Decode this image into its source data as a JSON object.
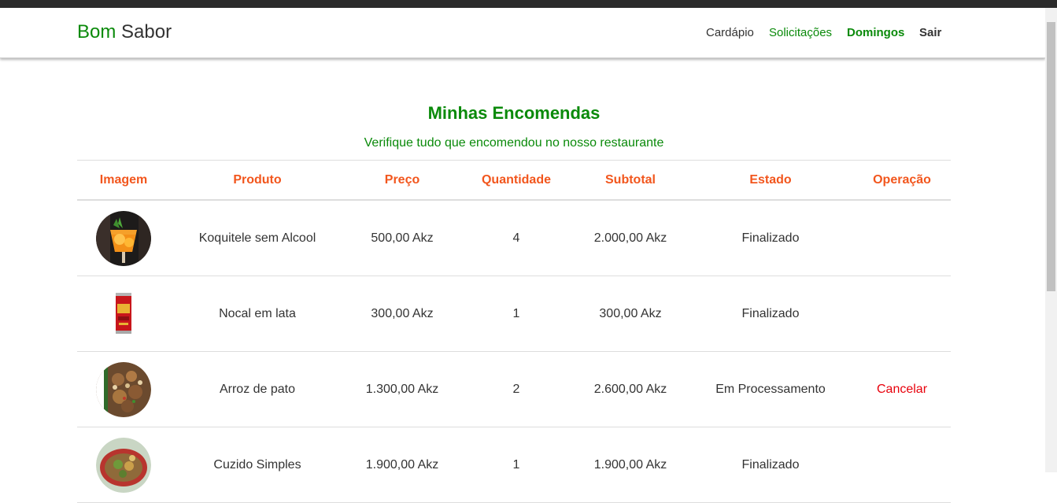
{
  "nav": {
    "brand_part1": "Bom",
    "brand_part2": "Sabor",
    "links": {
      "cardapio": "Cardápio",
      "solicitacoes": "Solicitações",
      "user": "Domingos",
      "sair": "Sair"
    }
  },
  "page": {
    "title": "Minhas Encomendas",
    "subtitle": "Verifique tudo que encomendou no nosso restaurante"
  },
  "table": {
    "headers": [
      "Imagem",
      "Produto",
      "Preço",
      "Quantidade",
      "Subtotal",
      "Estado",
      "Operação"
    ],
    "rows": [
      {
        "image": "cocktail-image",
        "produto": "Koquitele sem Alcool",
        "preco": "500,00 Akz",
        "quantidade": "4",
        "subtotal": "2.000,00 Akz",
        "estado": "Finalizado",
        "operacao": ""
      },
      {
        "image": "soda-can-image",
        "produto": "Nocal em lata",
        "preco": "300,00 Akz",
        "quantidade": "1",
        "subtotal": "300,00 Akz",
        "estado": "Finalizado",
        "operacao": ""
      },
      {
        "image": "rice-dish-image",
        "produto": "Arroz de pato",
        "preco": "1.300,00 Akz",
        "quantidade": "2",
        "subtotal": "2.600,00 Akz",
        "estado": "Em Processamento",
        "operacao": "Cancelar"
      },
      {
        "image": "stew-dish-image",
        "produto": "Cuzido Simples",
        "preco": "1.900,00 Akz",
        "quantidade": "1",
        "subtotal": "1.900,00 Akz",
        "estado": "Finalizado",
        "operacao": ""
      }
    ]
  },
  "colors": {
    "brand_green": "#0a8a0a",
    "header_orange": "#f2561d",
    "cancel_red": "#e8000b"
  }
}
